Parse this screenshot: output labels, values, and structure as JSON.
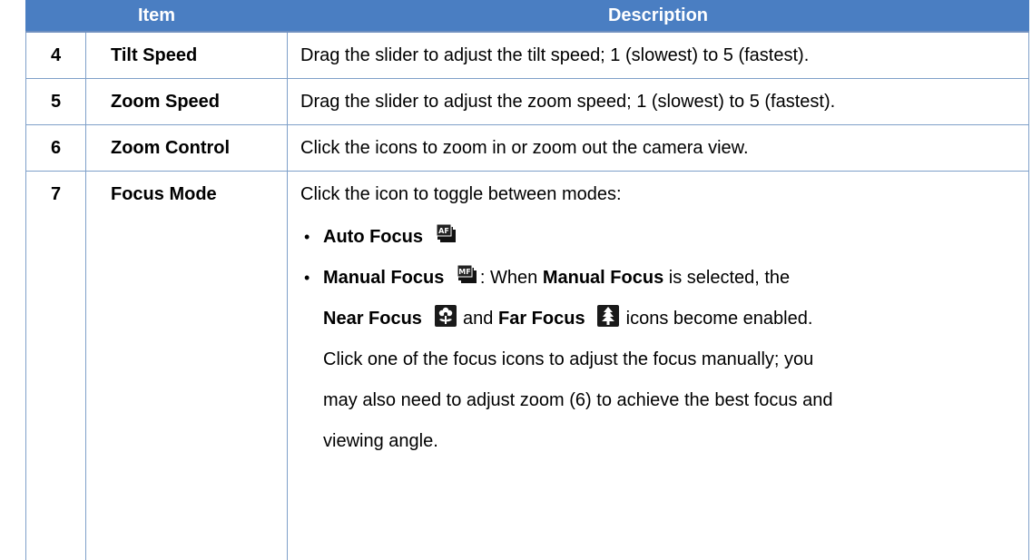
{
  "table": {
    "header": {
      "item": "Item",
      "description": "Description"
    },
    "rows": [
      {
        "num": "4",
        "item": "Tilt Speed",
        "desc": "Drag the slider to adjust the tilt speed; 1 (slowest) to 5 (fastest)."
      },
      {
        "num": "5",
        "item": "Zoom Speed",
        "desc": "Drag the slider to adjust the zoom speed; 1 (slowest) to 5 (fastest)."
      },
      {
        "num": "6",
        "item": "Zoom Control",
        "desc": "Click the icons to zoom in or zoom out the camera view."
      },
      {
        "num": "7",
        "item": "Focus Mode",
        "desc": "Click the icon to toggle between modes:"
      }
    ],
    "focus_modes": {
      "bullet": "•",
      "auto_focus": {
        "label": "Auto Focus",
        "icon": "auto-focus-icon",
        "icon_text": "AF"
      },
      "manual_focus": {
        "label": "Manual Focus",
        "icon": "manual-focus-icon",
        "icon_text": "MF",
        "text_colon": ": When ",
        "bold_label": "Manual Focus",
        "text_selected": " is selected, the",
        "near_focus_label": "Near Focus",
        "near_focus_icon": "near-focus-flower-icon",
        "text_and": " and ",
        "far_focus_label": "Far Focus",
        "far_focus_icon": "far-focus-tree-icon",
        "text_enabled": " icons become enabled.",
        "line3": "Click one of the focus icons to adjust the focus manually; you",
        "line4": "may also need to adjust zoom (6) to achieve the best focus and",
        "line5": "viewing angle."
      }
    }
  },
  "colors": {
    "header_bg": "#4a7ec2",
    "header_text": "#ffffff",
    "border": "#7fa0c9"
  }
}
